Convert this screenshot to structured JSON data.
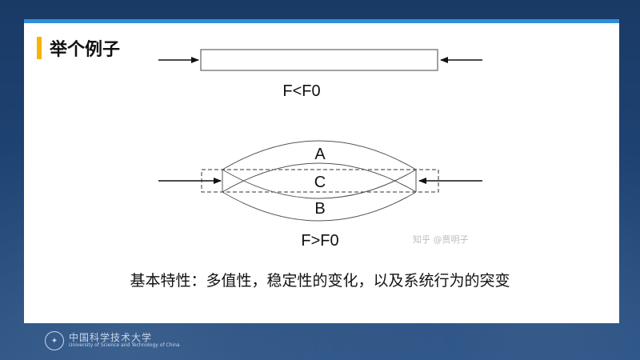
{
  "slide": {
    "title": "举个例子",
    "body": "基本特性：多值性，稳定性的变化，以及系统行为的突变"
  },
  "diagram": {
    "case1_label": "F<F0",
    "case2_label": "F>F0",
    "shape_labels": {
      "a": "A",
      "c": "C",
      "b": "B"
    }
  },
  "watermark": "知乎 @贾明子",
  "footer": {
    "cn": "中国科学技术大学",
    "en": "University of Science and Technology of China"
  },
  "colors": {
    "accent": "#f5b400",
    "top_bar": "#2e8fd8",
    "background": "#1c3f6e"
  }
}
